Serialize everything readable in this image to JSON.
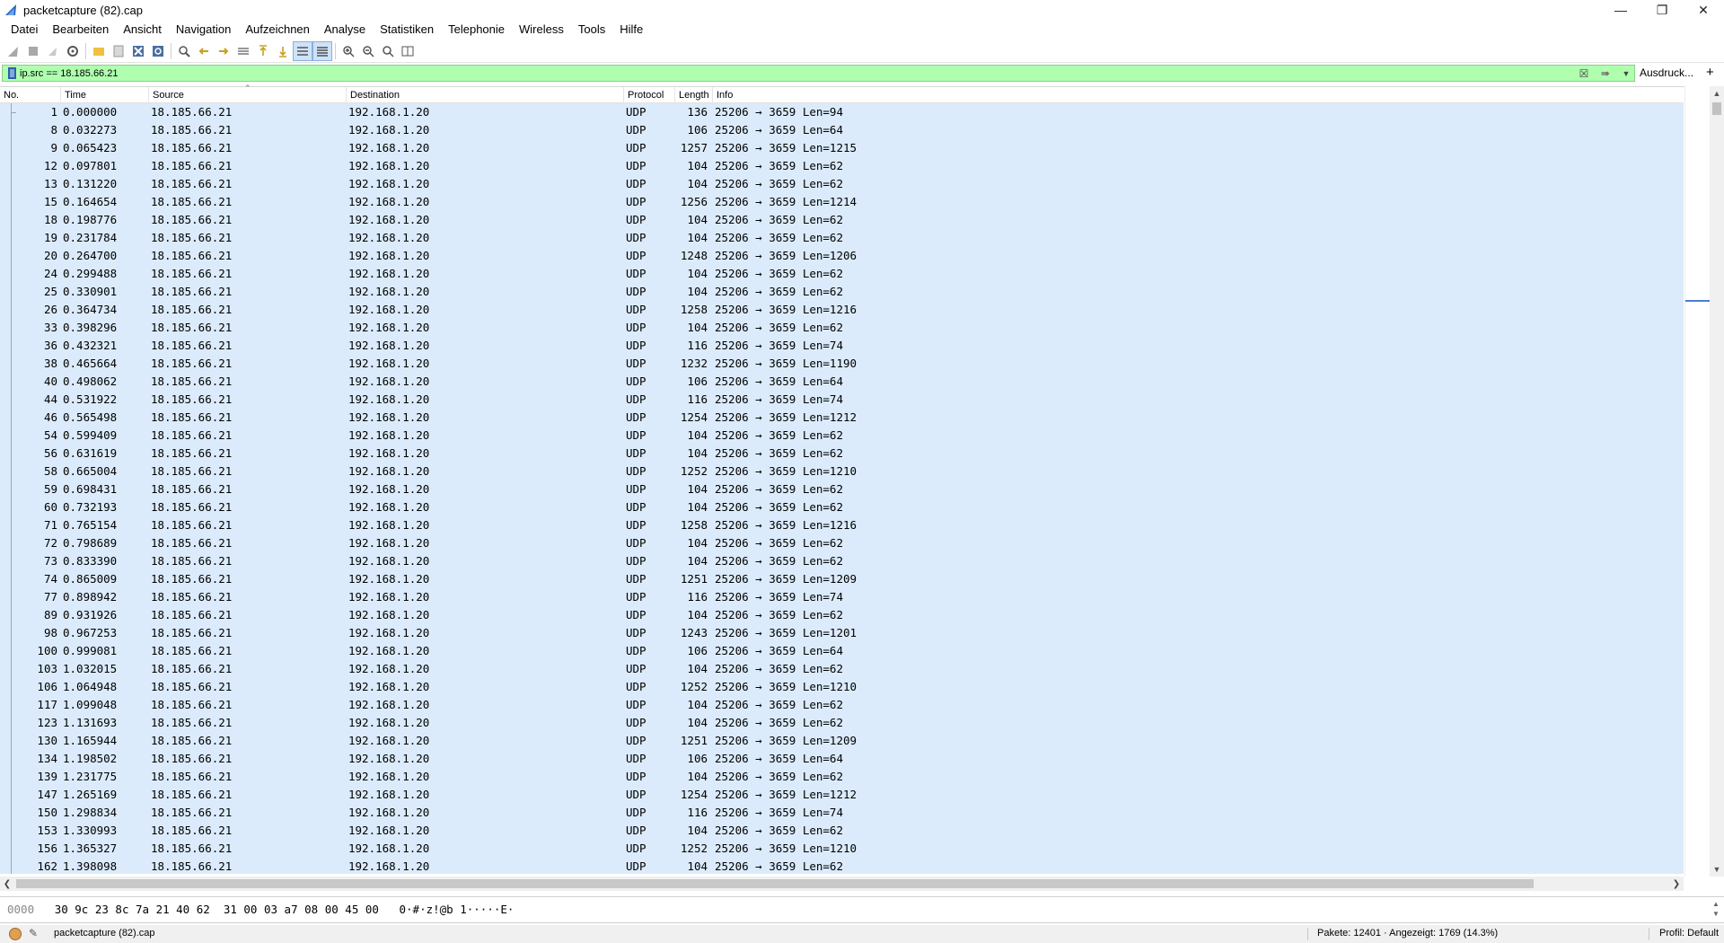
{
  "window": {
    "title": "packetcapture (82).cap"
  },
  "menu": [
    "Datei",
    "Bearbeiten",
    "Ansicht",
    "Navigation",
    "Aufzeichnen",
    "Analyse",
    "Statistiken",
    "Telephonie",
    "Wireless",
    "Tools",
    "Hilfe"
  ],
  "toolbar": {
    "icons": [
      "shark-fin-start-icon",
      "stop-icon",
      "restart-icon",
      "capture-options-icon",
      "open-folder-icon",
      "save-file-icon",
      "close-file-icon",
      "reload-file-icon",
      "find-packet-icon",
      "go-back-icon",
      "go-forward-icon",
      "go-to-packet-icon",
      "go-first-icon",
      "go-last-icon",
      "autoscroll-icon",
      "colorize-icon",
      "zoom-in-icon",
      "zoom-out-icon",
      "zoom-normal-icon",
      "resize-columns-icon"
    ]
  },
  "filter": {
    "value": "ip.src == 18.185.66.21",
    "expression_label": "Ausdruck...",
    "add_label": "+"
  },
  "columns": {
    "no": "No.",
    "time": "Time",
    "source": "Source",
    "destination": "Destination",
    "protocol": "Protocol",
    "length": "Length",
    "info": "Info"
  },
  "packets": [
    {
      "no": "1",
      "time": "0.000000",
      "src": "18.185.66.21",
      "dst": "192.168.1.20",
      "proto": "UDP",
      "len": "136",
      "info": "25206 → 3659 Len=94"
    },
    {
      "no": "8",
      "time": "0.032273",
      "src": "18.185.66.21",
      "dst": "192.168.1.20",
      "proto": "UDP",
      "len": "106",
      "info": "25206 → 3659 Len=64"
    },
    {
      "no": "9",
      "time": "0.065423",
      "src": "18.185.66.21",
      "dst": "192.168.1.20",
      "proto": "UDP",
      "len": "1257",
      "info": "25206 → 3659 Len=1215"
    },
    {
      "no": "12",
      "time": "0.097801",
      "src": "18.185.66.21",
      "dst": "192.168.1.20",
      "proto": "UDP",
      "len": "104",
      "info": "25206 → 3659 Len=62"
    },
    {
      "no": "13",
      "time": "0.131220",
      "src": "18.185.66.21",
      "dst": "192.168.1.20",
      "proto": "UDP",
      "len": "104",
      "info": "25206 → 3659 Len=62"
    },
    {
      "no": "15",
      "time": "0.164654",
      "src": "18.185.66.21",
      "dst": "192.168.1.20",
      "proto": "UDP",
      "len": "1256",
      "info": "25206 → 3659 Len=1214"
    },
    {
      "no": "18",
      "time": "0.198776",
      "src": "18.185.66.21",
      "dst": "192.168.1.20",
      "proto": "UDP",
      "len": "104",
      "info": "25206 → 3659 Len=62"
    },
    {
      "no": "19",
      "time": "0.231784",
      "src": "18.185.66.21",
      "dst": "192.168.1.20",
      "proto": "UDP",
      "len": "104",
      "info": "25206 → 3659 Len=62"
    },
    {
      "no": "20",
      "time": "0.264700",
      "src": "18.185.66.21",
      "dst": "192.168.1.20",
      "proto": "UDP",
      "len": "1248",
      "info": "25206 → 3659 Len=1206"
    },
    {
      "no": "24",
      "time": "0.299488",
      "src": "18.185.66.21",
      "dst": "192.168.1.20",
      "proto": "UDP",
      "len": "104",
      "info": "25206 → 3659 Len=62"
    },
    {
      "no": "25",
      "time": "0.330901",
      "src": "18.185.66.21",
      "dst": "192.168.1.20",
      "proto": "UDP",
      "len": "104",
      "info": "25206 → 3659 Len=62"
    },
    {
      "no": "26",
      "time": "0.364734",
      "src": "18.185.66.21",
      "dst": "192.168.1.20",
      "proto": "UDP",
      "len": "1258",
      "info": "25206 → 3659 Len=1216"
    },
    {
      "no": "33",
      "time": "0.398296",
      "src": "18.185.66.21",
      "dst": "192.168.1.20",
      "proto": "UDP",
      "len": "104",
      "info": "25206 → 3659 Len=62"
    },
    {
      "no": "36",
      "time": "0.432321",
      "src": "18.185.66.21",
      "dst": "192.168.1.20",
      "proto": "UDP",
      "len": "116",
      "info": "25206 → 3659 Len=74"
    },
    {
      "no": "38",
      "time": "0.465664",
      "src": "18.185.66.21",
      "dst": "192.168.1.20",
      "proto": "UDP",
      "len": "1232",
      "info": "25206 → 3659 Len=1190"
    },
    {
      "no": "40",
      "time": "0.498062",
      "src": "18.185.66.21",
      "dst": "192.168.1.20",
      "proto": "UDP",
      "len": "106",
      "info": "25206 → 3659 Len=64"
    },
    {
      "no": "44",
      "time": "0.531922",
      "src": "18.185.66.21",
      "dst": "192.168.1.20",
      "proto": "UDP",
      "len": "116",
      "info": "25206 → 3659 Len=74"
    },
    {
      "no": "46",
      "time": "0.565498",
      "src": "18.185.66.21",
      "dst": "192.168.1.20",
      "proto": "UDP",
      "len": "1254",
      "info": "25206 → 3659 Len=1212"
    },
    {
      "no": "54",
      "time": "0.599409",
      "src": "18.185.66.21",
      "dst": "192.168.1.20",
      "proto": "UDP",
      "len": "104",
      "info": "25206 → 3659 Len=62"
    },
    {
      "no": "56",
      "time": "0.631619",
      "src": "18.185.66.21",
      "dst": "192.168.1.20",
      "proto": "UDP",
      "len": "104",
      "info": "25206 → 3659 Len=62"
    },
    {
      "no": "58",
      "time": "0.665004",
      "src": "18.185.66.21",
      "dst": "192.168.1.20",
      "proto": "UDP",
      "len": "1252",
      "info": "25206 → 3659 Len=1210"
    },
    {
      "no": "59",
      "time": "0.698431",
      "src": "18.185.66.21",
      "dst": "192.168.1.20",
      "proto": "UDP",
      "len": "104",
      "info": "25206 → 3659 Len=62"
    },
    {
      "no": "60",
      "time": "0.732193",
      "src": "18.185.66.21",
      "dst": "192.168.1.20",
      "proto": "UDP",
      "len": "104",
      "info": "25206 → 3659 Len=62"
    },
    {
      "no": "71",
      "time": "0.765154",
      "src": "18.185.66.21",
      "dst": "192.168.1.20",
      "proto": "UDP",
      "len": "1258",
      "info": "25206 → 3659 Len=1216"
    },
    {
      "no": "72",
      "time": "0.798689",
      "src": "18.185.66.21",
      "dst": "192.168.1.20",
      "proto": "UDP",
      "len": "104",
      "info": "25206 → 3659 Len=62"
    },
    {
      "no": "73",
      "time": "0.833390",
      "src": "18.185.66.21",
      "dst": "192.168.1.20",
      "proto": "UDP",
      "len": "104",
      "info": "25206 → 3659 Len=62"
    },
    {
      "no": "74",
      "time": "0.865009",
      "src": "18.185.66.21",
      "dst": "192.168.1.20",
      "proto": "UDP",
      "len": "1251",
      "info": "25206 → 3659 Len=1209"
    },
    {
      "no": "77",
      "time": "0.898942",
      "src": "18.185.66.21",
      "dst": "192.168.1.20",
      "proto": "UDP",
      "len": "116",
      "info": "25206 → 3659 Len=74"
    },
    {
      "no": "89",
      "time": "0.931926",
      "src": "18.185.66.21",
      "dst": "192.168.1.20",
      "proto": "UDP",
      "len": "104",
      "info": "25206 → 3659 Len=62"
    },
    {
      "no": "98",
      "time": "0.967253",
      "src": "18.185.66.21",
      "dst": "192.168.1.20",
      "proto": "UDP",
      "len": "1243",
      "info": "25206 → 3659 Len=1201"
    },
    {
      "no": "100",
      "time": "0.999081",
      "src": "18.185.66.21",
      "dst": "192.168.1.20",
      "proto": "UDP",
      "len": "106",
      "info": "25206 → 3659 Len=64"
    },
    {
      "no": "103",
      "time": "1.032015",
      "src": "18.185.66.21",
      "dst": "192.168.1.20",
      "proto": "UDP",
      "len": "104",
      "info": "25206 → 3659 Len=62"
    },
    {
      "no": "106",
      "time": "1.064948",
      "src": "18.185.66.21",
      "dst": "192.168.1.20",
      "proto": "UDP",
      "len": "1252",
      "info": "25206 → 3659 Len=1210"
    },
    {
      "no": "117",
      "time": "1.099048",
      "src": "18.185.66.21",
      "dst": "192.168.1.20",
      "proto": "UDP",
      "len": "104",
      "info": "25206 → 3659 Len=62"
    },
    {
      "no": "123",
      "time": "1.131693",
      "src": "18.185.66.21",
      "dst": "192.168.1.20",
      "proto": "UDP",
      "len": "104",
      "info": "25206 → 3659 Len=62"
    },
    {
      "no": "130",
      "time": "1.165944",
      "src": "18.185.66.21",
      "dst": "192.168.1.20",
      "proto": "UDP",
      "len": "1251",
      "info": "25206 → 3659 Len=1209"
    },
    {
      "no": "134",
      "time": "1.198502",
      "src": "18.185.66.21",
      "dst": "192.168.1.20",
      "proto": "UDP",
      "len": "106",
      "info": "25206 → 3659 Len=64"
    },
    {
      "no": "139",
      "time": "1.231775",
      "src": "18.185.66.21",
      "dst": "192.168.1.20",
      "proto": "UDP",
      "len": "104",
      "info": "25206 → 3659 Len=62"
    },
    {
      "no": "147",
      "time": "1.265169",
      "src": "18.185.66.21",
      "dst": "192.168.1.20",
      "proto": "UDP",
      "len": "1254",
      "info": "25206 → 3659 Len=1212"
    },
    {
      "no": "150",
      "time": "1.298834",
      "src": "18.185.66.21",
      "dst": "192.168.1.20",
      "proto": "UDP",
      "len": "116",
      "info": "25206 → 3659 Len=74"
    },
    {
      "no": "153",
      "time": "1.330993",
      "src": "18.185.66.21",
      "dst": "192.168.1.20",
      "proto": "UDP",
      "len": "104",
      "info": "25206 → 3659 Len=62"
    },
    {
      "no": "156",
      "time": "1.365327",
      "src": "18.185.66.21",
      "dst": "192.168.1.20",
      "proto": "UDP",
      "len": "1252",
      "info": "25206 → 3659 Len=1210"
    },
    {
      "no": "162",
      "time": "1.398098",
      "src": "18.185.66.21",
      "dst": "192.168.1.20",
      "proto": "UDP",
      "len": "104",
      "info": "25206 → 3659 Len=62"
    }
  ],
  "bytes": {
    "offset": "0000",
    "hex": "30 9c 23 8c 7a 21 40 62  31 00 03 a7 08 00 45 00",
    "ascii": "0·#·z!@b 1·····E·"
  },
  "status": {
    "file": "packetcapture (82).cap",
    "stats": "Pakete: 12401 · Angezeigt: 1769 (14.3%)",
    "profile": "Profil: Default"
  },
  "colors": {
    "filter_valid": "#afffaf",
    "row_background": "#dbebfb",
    "status_led": "#e0a050"
  }
}
